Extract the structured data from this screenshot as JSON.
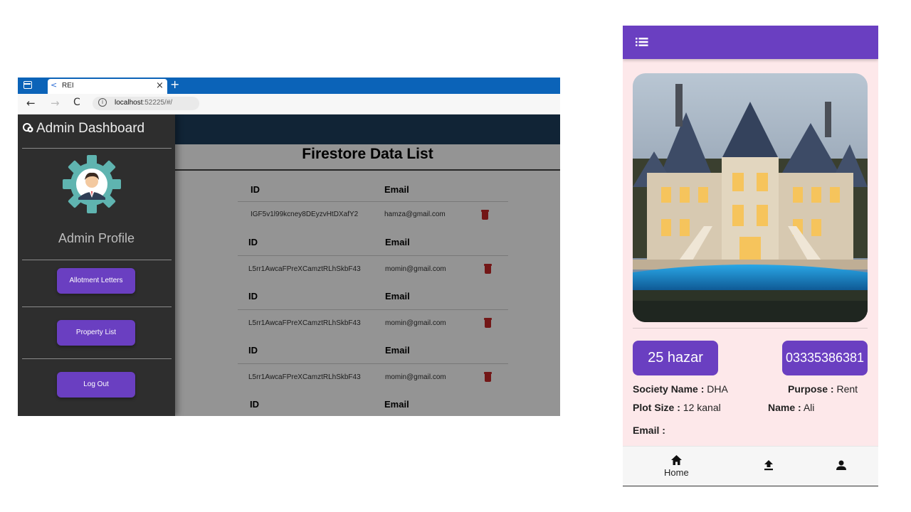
{
  "browser": {
    "tab_title": "REI",
    "tab_favicon": "<",
    "tab_close": "×",
    "new_tab": "+",
    "nav": {
      "back": "←",
      "forward": "→",
      "reload": "C"
    },
    "address_host": "localhost",
    "address_rest": ":52225/#/",
    "info_icon": "i"
  },
  "dashboard": {
    "title": "Admin Dashboard",
    "profile_label": "Admin Profile",
    "buttons": [
      "Allotment Letters",
      "Property List",
      "Log Out"
    ],
    "list_title": "Firestore Data List",
    "col_id": "ID",
    "col_email": "Email",
    "rows": [
      {
        "id": "IGF5v1l99kcney8DEyzvHtDXafY2",
        "email": "hamza@gmail.com"
      },
      {
        "id": "L5rr1AwcaFPreXCamztRLhSkbF43",
        "email": "momin@gmail.com"
      },
      {
        "id": "L5rr1AwcaFPreXCamztRLhSkbF43",
        "email": "momin@gmail.com"
      },
      {
        "id": "L5rr1AwcaFPreXCamztRLhSkbF43",
        "email": "momin@gmail.com"
      }
    ]
  },
  "app": {
    "price": "25 hazar",
    "phone": "03335386381",
    "society_label": "Society Name :",
    "society_value": "DHA",
    "purpose_label": "Purpose :",
    "purpose_value": "Rent",
    "plot_label": "Plot Size :",
    "plot_value": "12 kanal",
    "name_label": "Name :",
    "name_value": "Ali",
    "email_label": "Email :",
    "nav_home": "Home",
    "icons": [
      "menu-icon",
      "home-icon",
      "upload-icon",
      "person-icon"
    ]
  },
  "colors": {
    "purple": "#6a3fc1",
    "tabbar_blue": "#0b63b8",
    "header_navy": "#1e3e5e",
    "drawer_dark": "#2e2e2e",
    "card_pink": "#fde8ea",
    "trash_red": "#c62828"
  }
}
